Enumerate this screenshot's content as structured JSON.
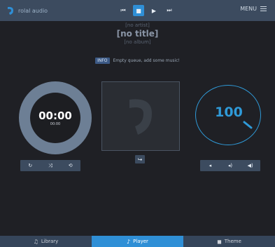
{
  "header": {
    "brand_text": "rolal audio",
    "menu_label": "MENU",
    "transport": [
      {
        "name": "skip-back",
        "glyph": "⏮"
      },
      {
        "name": "stop",
        "glyph": "■"
      },
      {
        "name": "play",
        "glyph": "▶"
      },
      {
        "name": "skip-forward",
        "glyph": "⏭"
      }
    ]
  },
  "track": {
    "artist": "[no artist]",
    "title": "[no title]",
    "album": "[no album]"
  },
  "notice": {
    "badge": "INFO",
    "message": "Empty queue, add some music!"
  },
  "timer": {
    "time": "00:00",
    "sub_time": "00:00"
  },
  "left_controls": [
    {
      "name": "repeat",
      "glyph": "↻"
    },
    {
      "name": "shuffle",
      "glyph": "⤨"
    },
    {
      "name": "loop",
      "glyph": "⟲"
    }
  ],
  "art": {
    "share_glyph": "↪"
  },
  "volume": {
    "value": "100",
    "level": 1.0
  },
  "right_controls": [
    {
      "name": "volume-down",
      "glyph": "◂"
    },
    {
      "name": "volume-up",
      "glyph": "◂)"
    },
    {
      "name": "mute",
      "glyph": "◀)"
    }
  ],
  "bottom_nav": [
    {
      "label": "Library",
      "glyph": "♫",
      "active": false
    },
    {
      "label": "Player",
      "glyph": "♪",
      "active": true
    },
    {
      "label": "Theme",
      "glyph": "◼",
      "active": false
    }
  ],
  "colors": {
    "accent": "#2f8fd6",
    "bar": "#3c4b5f",
    "background": "#1f2025"
  }
}
